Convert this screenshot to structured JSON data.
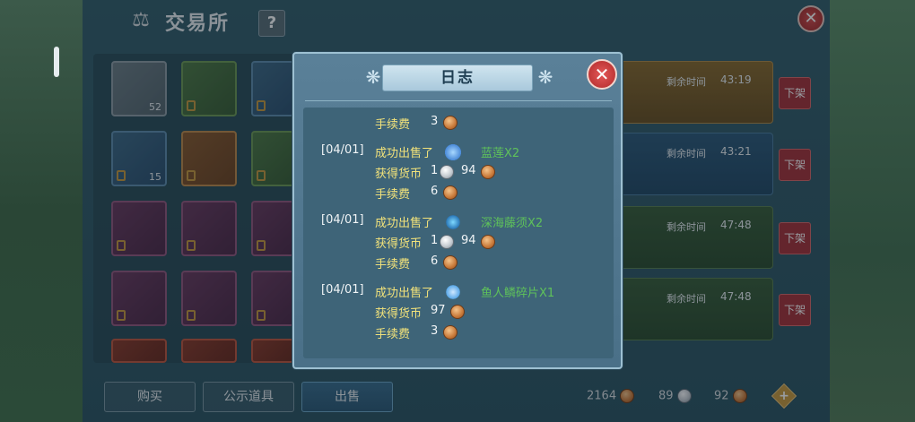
{
  "exchange": {
    "title": "交易所",
    "help_label": "?",
    "close_label": "✕",
    "grid_qty": {
      "wood": "52",
      "gem": "15"
    },
    "listings": [
      {
        "time_label": "剩余时间",
        "time_value": "43:19",
        "off_label": "下架"
      },
      {
        "time_label": "剩余时间",
        "time_value": "43:21",
        "off_label": "下架"
      },
      {
        "time_label": "剩余时间",
        "time_value": "47:48",
        "off_label": "下架"
      },
      {
        "time_label": "剩余时间",
        "time_value": "47:48",
        "off_label": "下架"
      }
    ],
    "tabs": {
      "buy": "购买",
      "showcase": "公示道具",
      "sell": "出售"
    },
    "currency": {
      "bronze_total": "2164",
      "silver_total": "89",
      "other_total": "92"
    }
  },
  "log_modal": {
    "title": "日志",
    "close_label": "✕",
    "entries": {
      "top_fee": {
        "label": "手续费",
        "value": "3"
      },
      "e1": {
        "date": "[04/01]",
        "action": "成功出售了",
        "item": "蓝莲X2",
        "income_label": "获得货币",
        "income_silver": "1",
        "income_bronze": "94",
        "fee_label": "手续费",
        "fee_value": "6"
      },
      "e2": {
        "date": "[04/01]",
        "action": "成功出售了",
        "item": "深海藤须X2",
        "income_label": "获得货币",
        "income_silver": "1",
        "income_bronze": "94",
        "fee_label": "手续费",
        "fee_value": "6"
      },
      "e3": {
        "date": "[04/01]",
        "action": "成功出售了",
        "item": "鱼人鳞碎片X1",
        "income_label": "获得货币",
        "income_bronze": "97",
        "fee_label": "手续费",
        "fee_value": "3"
      }
    }
  },
  "colors": {
    "accent_yellow": "#f2e27a",
    "item_green": "#5fc25a",
    "close_red": "#d44c4c"
  }
}
